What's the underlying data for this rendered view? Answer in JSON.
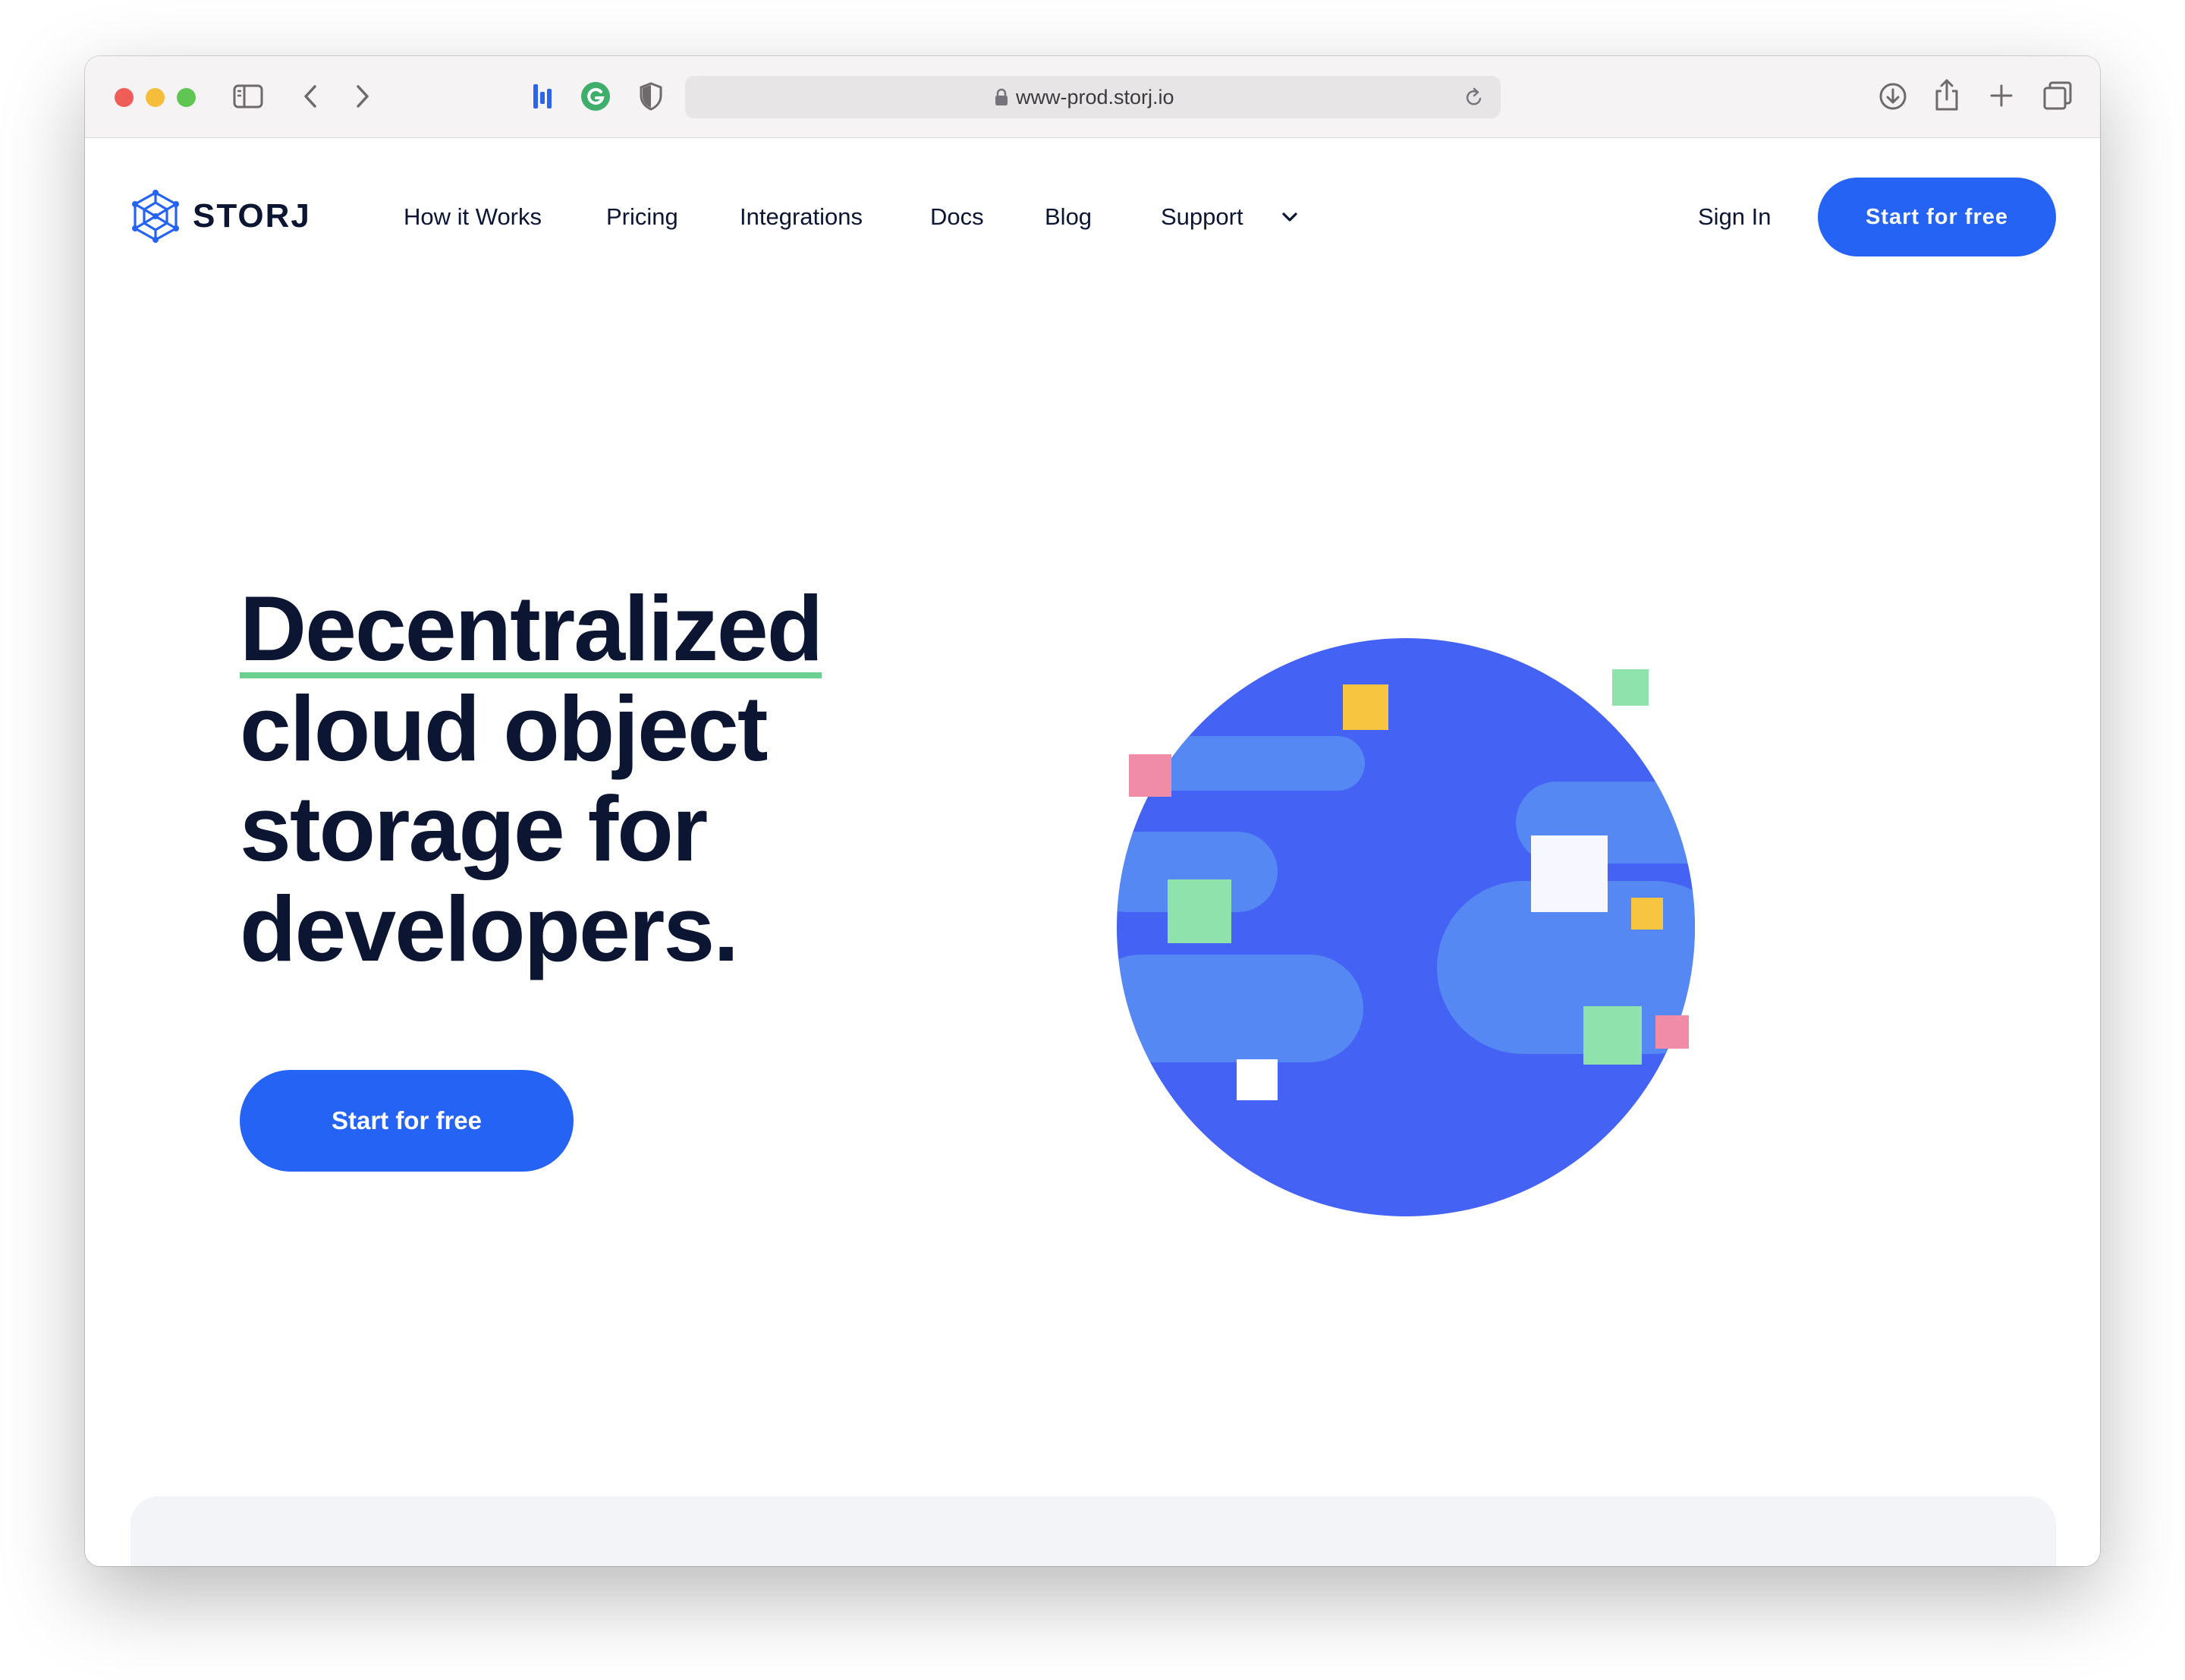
{
  "browser": {
    "url": "www-prod.storj.io",
    "icons": [
      "sidebar-icon",
      "back-icon",
      "forward-icon",
      "extension-bars-icon",
      "grammarly-icon",
      "privacy-shield-icon",
      "lock-icon",
      "reload-icon",
      "download-icon",
      "share-icon",
      "new-tab-icon",
      "tabs-overview-icon"
    ]
  },
  "header": {
    "logo_text": "STORJ",
    "nav": {
      "how_it_works": "How it Works",
      "pricing": "Pricing",
      "integrations": "Integrations",
      "docs": "Docs",
      "blog": "Blog",
      "support": "Support"
    },
    "sign_in": "Sign In",
    "cta": "Start for free"
  },
  "hero": {
    "title_line1": "Decentralized",
    "title_line2": "cloud object",
    "title_line3": "storage for",
    "title_line4": "developers.",
    "cta": "Start for free"
  },
  "colors": {
    "brand_blue": "#2563f5",
    "globe_blue": "#4462f4",
    "globe_band": "#5588f3",
    "accent_green": "#6bd08d",
    "square_yellow": "#f8c540",
    "square_pink": "#f08ba8",
    "square_green": "#8fe2ab",
    "text_navy": "#0c1633"
  }
}
